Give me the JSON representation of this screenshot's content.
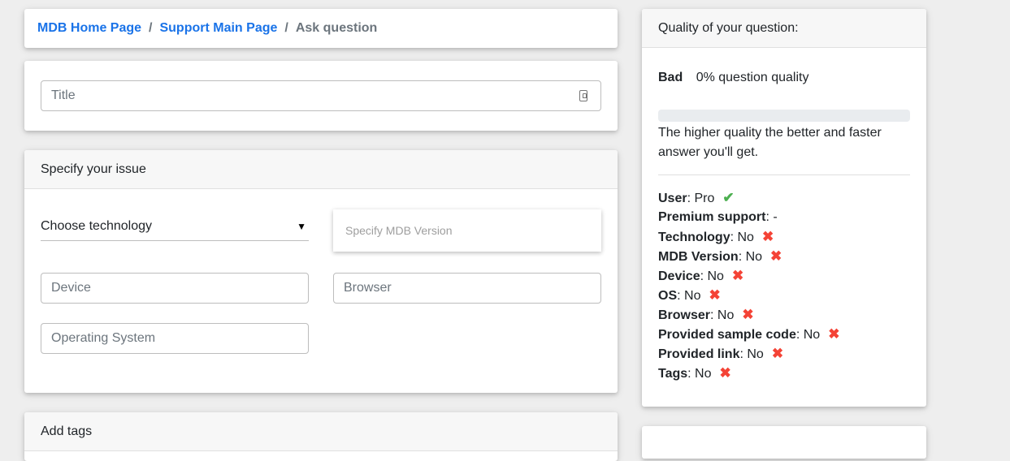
{
  "breadcrumb": {
    "items": [
      "MDB Home Page",
      "Support Main Page"
    ],
    "separator": "/",
    "current": "Ask question"
  },
  "title_field": {
    "placeholder": "Title",
    "icon": "contact-card-icon"
  },
  "issue": {
    "header": "Specify your issue",
    "technology_select": "Choose technology",
    "mdb_version_placeholder": "Specify MDB Version",
    "device_placeholder": "Device",
    "browser_placeholder": "Browser",
    "os_placeholder": "Operating System"
  },
  "tags": {
    "header": "Add tags"
  },
  "quality": {
    "header": "Quality of your question:",
    "rating": "Bad",
    "percent_text": "0% question quality",
    "progress_percent": 0,
    "note": "The higher quality the better and faster answer you'll get.",
    "criteria": [
      {
        "label": "User",
        "value": "Pro",
        "status": "ok"
      },
      {
        "label": "Premium support",
        "value": "-",
        "status": "none"
      },
      {
        "label": "Technology",
        "value": "No",
        "status": "no"
      },
      {
        "label": "MDB Version",
        "value": "No",
        "status": "no"
      },
      {
        "label": "Device",
        "value": "No",
        "status": "no"
      },
      {
        "label": "OS",
        "value": "No",
        "status": "no"
      },
      {
        "label": "Browser",
        "value": "No",
        "status": "no"
      },
      {
        "label": "Provided sample code",
        "value": "No",
        "status": "no"
      },
      {
        "label": "Provided link",
        "value": "No",
        "status": "no"
      },
      {
        "label": "Tags",
        "value": "No",
        "status": "no"
      }
    ]
  },
  "colors": {
    "link": "#1a73e8",
    "ok": "#4caf50",
    "no": "#f44336"
  }
}
